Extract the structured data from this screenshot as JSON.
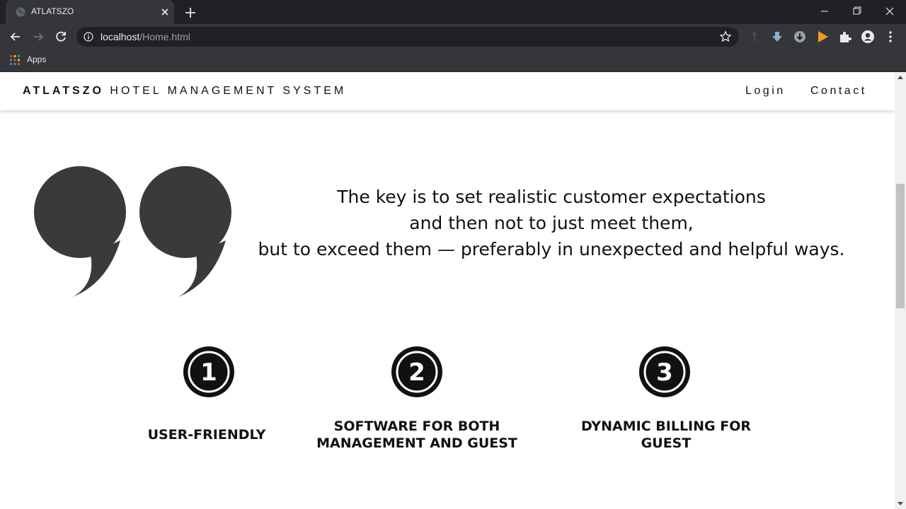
{
  "browser": {
    "tab_title": "ATLATSZO",
    "url_host": "localhost",
    "url_path": "/Home.html",
    "bookmarks_apps_label": "Apps"
  },
  "site": {
    "brand_bold": "ATLATSZO",
    "brand_rest": "HOTEL MANAGEMENT SYSTEM",
    "nav": {
      "login": "Login",
      "contact": "Contact"
    }
  },
  "quote": {
    "line1": "The key is to set realistic customer expectations",
    "line2": "and then not to just meet them,",
    "line3": "but to exceed them — preferably in unexpected and helpful ways."
  },
  "features": [
    {
      "number": "1",
      "title_line1": "USER-FRIENDLY",
      "title_line2": ""
    },
    {
      "number": "2",
      "title_line1": "SOFTWARE FOR BOTH",
      "title_line2": "MANAGEMENT AND GUEST"
    },
    {
      "number": "3",
      "title_line1": "DYNAMIC BILLING FOR",
      "title_line2": "GUEST"
    }
  ],
  "colors": {
    "chrome_dark": "#202124",
    "chrome_toolbar": "#35363a",
    "quote_mark": "#3a3a3a",
    "accent_play": "#f29b1d"
  }
}
